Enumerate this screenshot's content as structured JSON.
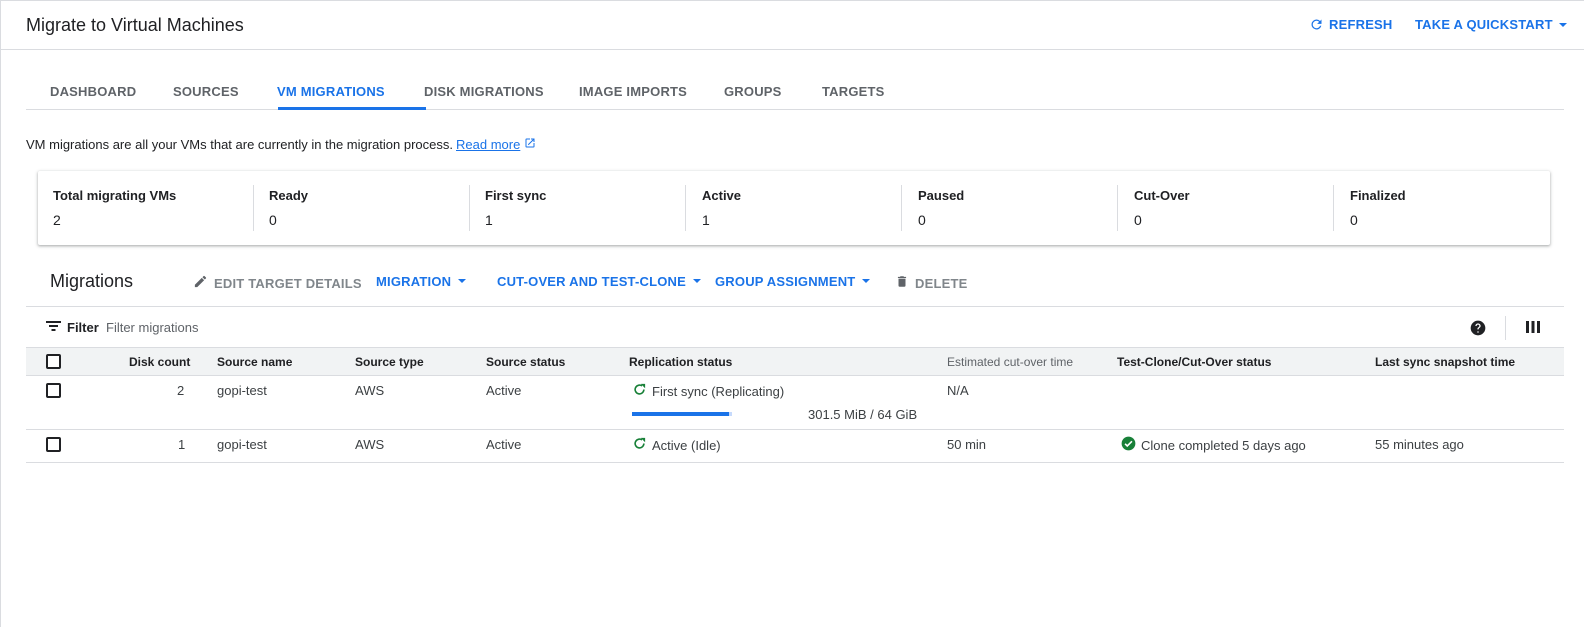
{
  "header": {
    "title": "Migrate to Virtual Machines",
    "refresh_label": "REFRESH",
    "quickstart_label": "TAKE A QUICKSTART"
  },
  "tabs": [
    {
      "label": "DASHBOARD"
    },
    {
      "label": "SOURCES"
    },
    {
      "label": "VM MIGRATIONS",
      "active": true
    },
    {
      "label": "DISK MIGRATIONS"
    },
    {
      "label": "IMAGE IMPORTS"
    },
    {
      "label": "GROUPS"
    },
    {
      "label": "TARGETS"
    }
  ],
  "description": {
    "text": "VM migrations are all your VMs that are currently in the migration process.",
    "link": "Read more"
  },
  "stats": [
    {
      "label": "Total migrating VMs",
      "value": "2"
    },
    {
      "label": "Ready",
      "value": "0"
    },
    {
      "label": "First sync",
      "value": "1"
    },
    {
      "label": "Active",
      "value": "1"
    },
    {
      "label": "Paused",
      "value": "0"
    },
    {
      "label": "Cut-Over",
      "value": "0"
    },
    {
      "label": "Finalized",
      "value": "0"
    }
  ],
  "toolbar": {
    "title": "Migrations",
    "edit_label": "EDIT TARGET DETAILS",
    "migration_label": "MIGRATION",
    "cutover_label": "CUT-OVER AND TEST-CLONE",
    "group_label": "GROUP ASSIGNMENT",
    "delete_label": "DELETE"
  },
  "filter": {
    "label": "Filter",
    "placeholder": "Filter migrations"
  },
  "table": {
    "columns": {
      "disk_count": "Disk count",
      "source_name": "Source name",
      "source_type": "Source type",
      "source_status": "Source status",
      "replication_status": "Replication status",
      "est_cutover": "Estimated cut-over time",
      "test_clone_status": "Test-Clone/Cut-Over status",
      "last_sync": "Last sync snapshot time"
    },
    "rows": [
      {
        "disk_count": "2",
        "source_name": "gopi-test",
        "source_type": "AWS",
        "source_status": "Active",
        "replication_status": "First sync (Replicating)",
        "progress_text": "301.5 MiB / 64 GiB",
        "progress_fraction": 0.97,
        "est_cutover": "N/A",
        "test_clone_status": "",
        "last_sync": ""
      },
      {
        "disk_count": "1",
        "source_name": "gopi-test",
        "source_type": "AWS",
        "source_status": "Active",
        "replication_status": "Active (Idle)",
        "est_cutover": "50 min",
        "test_clone_status": "Clone completed 5 days ago",
        "last_sync": "55 minutes ago"
      }
    ]
  },
  "colors": {
    "accent": "#1a73e8",
    "success": "#188038",
    "divider": "#dadce0"
  }
}
